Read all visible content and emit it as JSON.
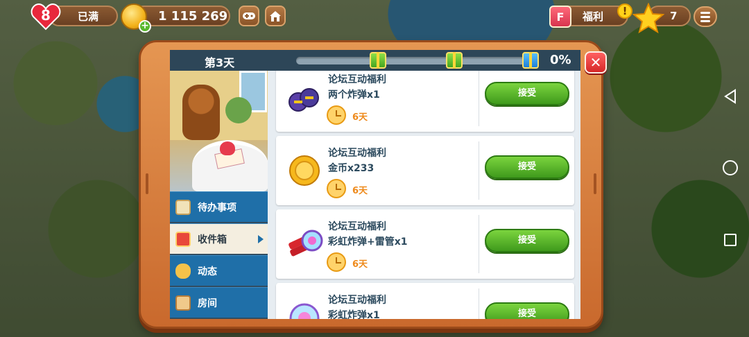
{
  "hud": {
    "lives": "8",
    "lives_status": "已满",
    "coins": "1 115 269",
    "gift_label": "福利",
    "gift_icon_char": "F",
    "alert_char": "!",
    "stars": "7"
  },
  "panel": {
    "day_label": "第3天",
    "progress_percent": "0%",
    "progress_value": 0,
    "close_char": "✕",
    "menu": [
      {
        "label": "待办事项",
        "icon": "checklist-icon"
      },
      {
        "label": "收件箱",
        "icon": "envelope-icon",
        "active": true
      },
      {
        "label": "动态",
        "icon": "chat-icon"
      },
      {
        "label": "房间",
        "icon": "house-icon"
      }
    ]
  },
  "inbox": [
    {
      "title": "论坛互动福利",
      "reward": "两个炸弹x1",
      "time": "6天",
      "button": "接受",
      "icon": "bomb-icon"
    },
    {
      "title": "论坛互动福利",
      "reward": "金币x233",
      "time": "6天",
      "button": "接受",
      "icon": "coin-icon"
    },
    {
      "title": "论坛互动福利",
      "reward": "彩虹炸弹+雷管x1",
      "time": "6天",
      "button": "接受",
      "icon": "rainbow-dynamite-icon"
    },
    {
      "title": "论坛互动福利",
      "reward": "彩虹炸弹x1",
      "time": "",
      "button": "接受",
      "icon": "rainbow-bomb-icon"
    }
  ],
  "colors": {
    "accent_green": "#5cb82a",
    "header_navy": "#2d4658",
    "tab_blue": "#1f6fa8",
    "frame_orange": "#d9793a",
    "text_orange": "#ee8a1c"
  }
}
